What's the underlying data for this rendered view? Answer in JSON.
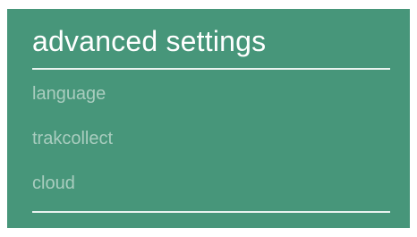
{
  "panel": {
    "title": "advanced settings",
    "background_color": "#47967a",
    "items": [
      {
        "label": "language"
      },
      {
        "label": "trakcollect"
      },
      {
        "label": "cloud"
      }
    ]
  }
}
